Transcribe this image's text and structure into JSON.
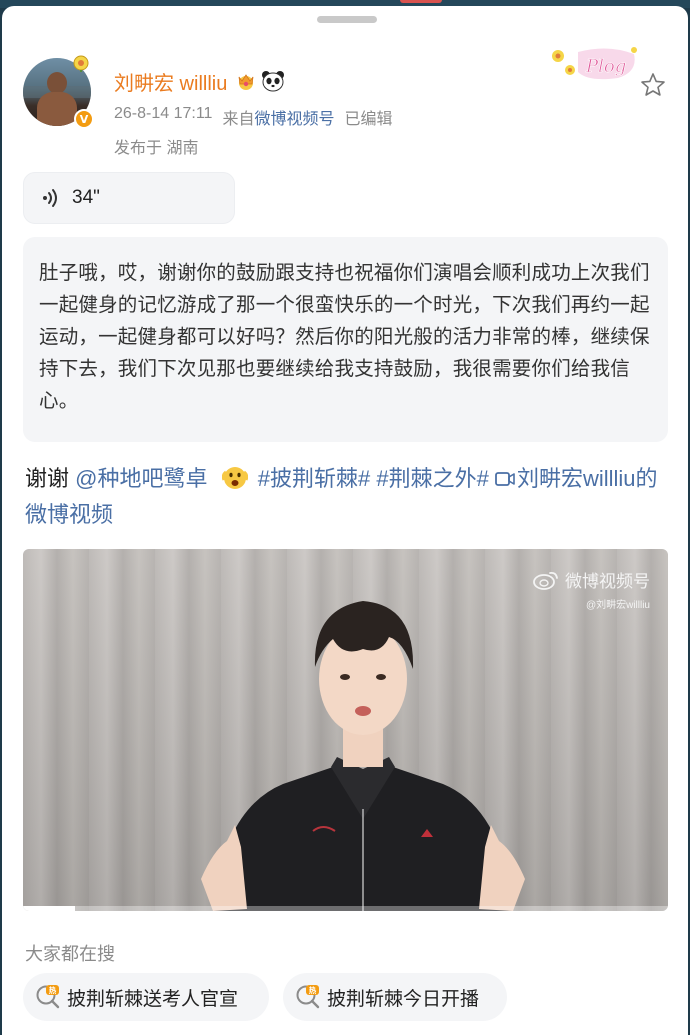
{
  "post": {
    "username": "刘畊宏 willliu",
    "timestamp": "26-8-14 17:11",
    "source_prefix": "来自",
    "source": "微博视频号",
    "edited": "已编辑",
    "location": "发布于 湖南",
    "verified_badge": "V"
  },
  "voice": {
    "duration": "34\""
  },
  "transcript": "肚子哦，哎，谢谢你的鼓励跟支持也祝福你们演唱会顺利成功上次我们一起健身的记忆游成了那一个很蛮快乐的一个时光，下次我们再约一起运动，一起健身都可以好吗？然后你的阳光般的活力非常的棒，继续保持下去，我们下次见那也要继续给我支持鼓励，我很需要你们给我信心。",
  "caption": {
    "thanks": "谢谢",
    "mention": "@种地吧鹭卓",
    "hashtag1": "#披荆斩棘#",
    "hashtag2": "#荆棘之外#",
    "video_link": "刘畊宏willliu的微博视频"
  },
  "video": {
    "watermark_main": "微博视频号",
    "watermark_sub": "@刘畊宏willliu",
    "progress": 0.08
  },
  "search": {
    "label": "大家都在搜",
    "chips": [
      "披荆斩棘送考人官宣",
      "披荆斩棘今日开播"
    ]
  },
  "colors": {
    "username": "#ea7b1f",
    "link": "#4a6fa5",
    "hot": "#f39c12"
  },
  "icons": [
    "crown-icon",
    "panda-icon",
    "vlog-sticker",
    "star-icon",
    "voice-icon",
    "emoji-face-icon",
    "video-link-icon",
    "weibo-icon",
    "hot-search-icon"
  ]
}
